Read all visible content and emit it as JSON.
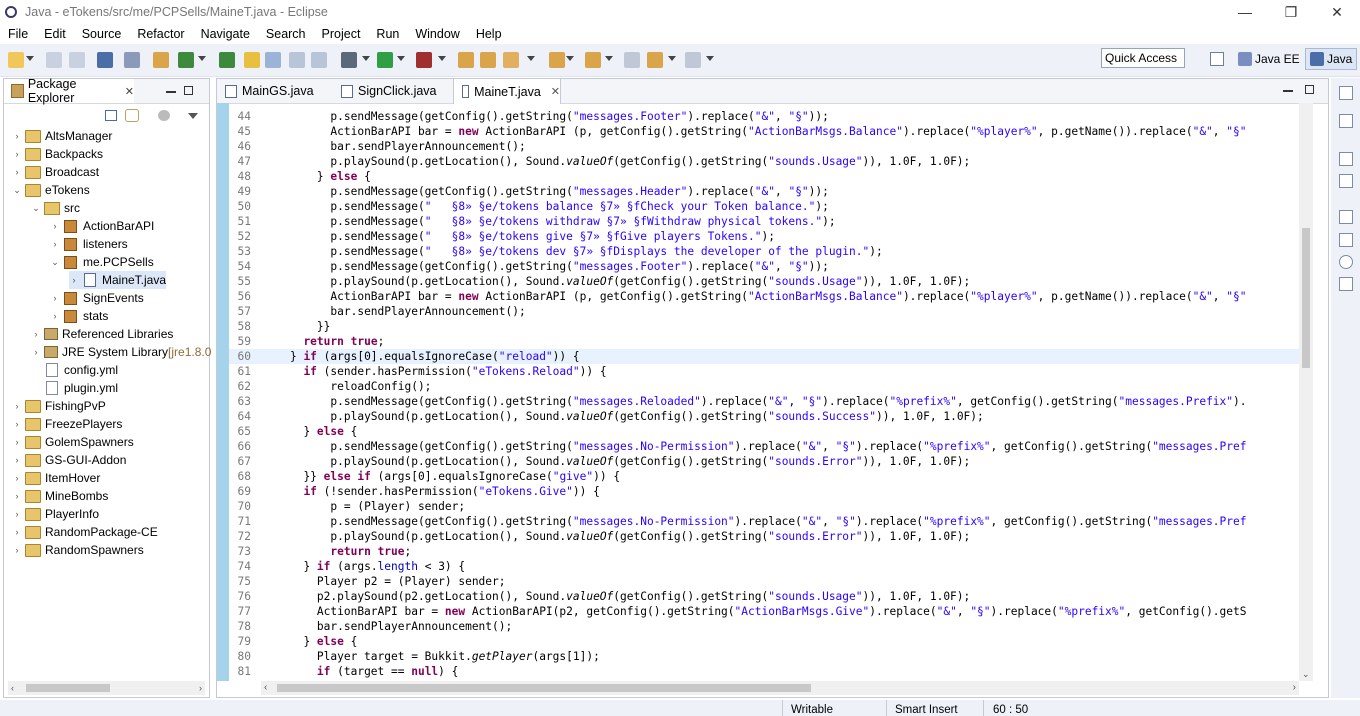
{
  "window": {
    "title": "Java - eTokens/src/me/PCPSells/MaineT.java - Eclipse",
    "minimize": "—",
    "restore": "❐",
    "close": "✕"
  },
  "menu": [
    "File",
    "Edit",
    "Source",
    "Refactor",
    "Navigate",
    "Search",
    "Project",
    "Run",
    "Window",
    "Help"
  ],
  "toolbar": {
    "quick_access": "Quick Access",
    "perspectives": [
      "Java EE",
      "Java"
    ]
  },
  "package_explorer": {
    "title": "Package Explorer",
    "close": "✕",
    "items": [
      {
        "label": "AltsManager",
        "icon": "project-icon",
        "twisty": "›"
      },
      {
        "label": "Backpacks",
        "icon": "project-icon",
        "twisty": "›"
      },
      {
        "label": "Broadcast",
        "icon": "project-icon",
        "twisty": "›"
      },
      {
        "label": "eTokens",
        "icon": "project-icon",
        "twisty": "⌄"
      },
      {
        "label": "src",
        "icon": "source-folder-icon",
        "twisty": "⌄"
      },
      {
        "label": "ActionBarAPI",
        "icon": "package-icon",
        "twisty": "›"
      },
      {
        "label": "listeners",
        "icon": "package-icon",
        "twisty": "›"
      },
      {
        "label": "me.PCPSells",
        "icon": "package-icon",
        "twisty": "⌄"
      },
      {
        "label": "MaineT.java",
        "icon": "java-file-icon",
        "twisty": "›"
      },
      {
        "label": "SignEvents",
        "icon": "package-icon",
        "twisty": "›"
      },
      {
        "label": "stats",
        "icon": "package-icon",
        "twisty": "›"
      },
      {
        "label": "Referenced Libraries",
        "icon": "library-icon",
        "twisty": "›"
      },
      {
        "label": "JRE System Library",
        "suffix": " [jre1.8.0",
        "icon": "library-icon",
        "twisty": "›"
      },
      {
        "label": "config.yml",
        "icon": "yml-file-icon",
        "twisty": ""
      },
      {
        "label": "plugin.yml",
        "icon": "yml-file-icon",
        "twisty": ""
      },
      {
        "label": "FishingPvP",
        "icon": "project-icon",
        "twisty": "›"
      },
      {
        "label": "FreezePlayers",
        "icon": "project-icon",
        "twisty": "›"
      },
      {
        "label": "GolemSpawners",
        "icon": "project-icon",
        "twisty": "›"
      },
      {
        "label": "GS-GUI-Addon",
        "icon": "project-icon",
        "twisty": "›"
      },
      {
        "label": "ItemHover",
        "icon": "project-icon",
        "twisty": "›"
      },
      {
        "label": "MineBombs",
        "icon": "project-icon",
        "twisty": "›"
      },
      {
        "label": "PlayerInfo",
        "icon": "project-icon",
        "twisty": "›"
      },
      {
        "label": "RandomPackage-CE",
        "icon": "project-icon",
        "twisty": "›"
      },
      {
        "label": "RandomSpawners",
        "icon": "project-icon",
        "twisty": "›"
      }
    ]
  },
  "editor": {
    "tabs": [
      {
        "label": "MainGS.java",
        "active": false
      },
      {
        "label": "SignClick.java",
        "active": false
      },
      {
        "label": "MaineT.java",
        "active": true
      }
    ],
    "tab_close": "✕",
    "lines": [
      {
        "n": "44",
        "indent": 10,
        "tokens": [
          [
            "p.sendMessage(getConfig().getString(",
            ""
          ],
          [
            "\"messages.Footer\"",
            "str"
          ],
          [
            ").replace(",
            ""
          ],
          [
            "\"&\"",
            "str"
          ],
          [
            ", ",
            ""
          ],
          [
            "\"§\"",
            "str"
          ],
          [
            "));",
            ""
          ]
        ]
      },
      {
        "n": "45",
        "indent": 10,
        "tokens": [
          [
            "ActionBarAPI bar = ",
            ""
          ],
          [
            "new",
            "kw"
          ],
          [
            " ActionBarAPI (p, getConfig().getString(",
            ""
          ],
          [
            "\"ActionBarMsgs.Balance\"",
            "str"
          ],
          [
            ").replace(",
            ""
          ],
          [
            "\"%player%\"",
            "str"
          ],
          [
            ", p.getName()).replace(",
            ""
          ],
          [
            "\"&\"",
            "str"
          ],
          [
            ", ",
            ""
          ],
          [
            "\"§\"",
            "str"
          ]
        ]
      },
      {
        "n": "46",
        "indent": 10,
        "tokens": [
          [
            "bar.sendPlayerAnnouncement();",
            ""
          ]
        ]
      },
      {
        "n": "47",
        "indent": 10,
        "tokens": [
          [
            "p.playSound(p.getLocation(), Sound.",
            ""
          ],
          [
            "valueOf",
            "it"
          ],
          [
            "(getConfig().getString(",
            ""
          ],
          [
            "\"sounds.Usage\"",
            "str"
          ],
          [
            ")), 1.0F, 1.0F);",
            ""
          ]
        ]
      },
      {
        "n": "48",
        "indent": 8,
        "tokens": [
          [
            "} ",
            ""
          ],
          [
            "else",
            "kw"
          ],
          [
            " {",
            ""
          ]
        ]
      },
      {
        "n": "49",
        "indent": 10,
        "tokens": [
          [
            "p.sendMessage(getConfig().getString(",
            ""
          ],
          [
            "\"messages.Header\"",
            "str"
          ],
          [
            ").replace(",
            ""
          ],
          [
            "\"&\"",
            "str"
          ],
          [
            ", ",
            ""
          ],
          [
            "\"§\"",
            "str"
          ],
          [
            "));",
            ""
          ]
        ]
      },
      {
        "n": "50",
        "indent": 10,
        "tokens": [
          [
            "p.sendMessage(",
            ""
          ],
          [
            "\"   §8» §e/tokens balance §7» §fCheck your Token balance.\"",
            "str"
          ],
          [
            ");",
            ""
          ]
        ]
      },
      {
        "n": "51",
        "indent": 10,
        "tokens": [
          [
            "p.sendMessage(",
            ""
          ],
          [
            "\"   §8» §e/tokens withdraw §7» §fWithdraw physical tokens.\"",
            "str"
          ],
          [
            ");",
            ""
          ]
        ]
      },
      {
        "n": "52",
        "indent": 10,
        "tokens": [
          [
            "p.sendMessage(",
            ""
          ],
          [
            "\"   §8» §e/tokens give §7» §fGive players Tokens.\"",
            "str"
          ],
          [
            ");",
            ""
          ]
        ]
      },
      {
        "n": "53",
        "indent": 10,
        "tokens": [
          [
            "p.sendMessage(",
            ""
          ],
          [
            "\"   §8» §e/tokens dev §7» §fDisplays the developer of the plugin.\"",
            "str"
          ],
          [
            ");",
            ""
          ]
        ]
      },
      {
        "n": "54",
        "indent": 10,
        "tokens": [
          [
            "p.sendMessage(getConfig().getString(",
            ""
          ],
          [
            "\"messages.Footer\"",
            "str"
          ],
          [
            ").replace(",
            ""
          ],
          [
            "\"&\"",
            "str"
          ],
          [
            ", ",
            ""
          ],
          [
            "\"§\"",
            "str"
          ],
          [
            "));",
            ""
          ]
        ]
      },
      {
        "n": "55",
        "indent": 10,
        "tokens": [
          [
            "p.playSound(p.getLocation(), Sound.",
            ""
          ],
          [
            "valueOf",
            "it"
          ],
          [
            "(getConfig().getString(",
            ""
          ],
          [
            "\"sounds.Usage\"",
            "str"
          ],
          [
            ")), 1.0F, 1.0F);",
            ""
          ]
        ]
      },
      {
        "n": "56",
        "indent": 10,
        "tokens": [
          [
            "ActionBarAPI bar = ",
            ""
          ],
          [
            "new",
            "kw"
          ],
          [
            " ActionBarAPI (p, getConfig().getString(",
            ""
          ],
          [
            "\"ActionBarMsgs.Balance\"",
            "str"
          ],
          [
            ").replace(",
            ""
          ],
          [
            "\"%player%\"",
            "str"
          ],
          [
            ", p.getName()).replace(",
            ""
          ],
          [
            "\"&\"",
            "str"
          ],
          [
            ", ",
            ""
          ],
          [
            "\"§\"",
            "str"
          ]
        ]
      },
      {
        "n": "57",
        "indent": 10,
        "tokens": [
          [
            "bar.sendPlayerAnnouncement();",
            ""
          ]
        ]
      },
      {
        "n": "58",
        "indent": 8,
        "tokens": [
          [
            "}}",
            ""
          ]
        ]
      },
      {
        "n": "59",
        "indent": 6,
        "tokens": [
          [
            "return",
            "kw"
          ],
          [
            " ",
            ""
          ],
          [
            "true",
            "kw"
          ],
          [
            ";",
            ""
          ]
        ]
      },
      {
        "n": "60",
        "indent": 4,
        "hl": true,
        "tokens": [
          [
            "} ",
            ""
          ],
          [
            "if",
            "kw"
          ],
          [
            " (args[0].equalsIgnoreCase(",
            ""
          ],
          [
            "\"reload\"",
            "str"
          ],
          [
            ")) {",
            ""
          ]
        ]
      },
      {
        "n": "61",
        "indent": 6,
        "tokens": [
          [
            "if",
            "kw"
          ],
          [
            " (sender.hasPermission(",
            ""
          ],
          [
            "\"eTokens.Reload\"",
            "str"
          ],
          [
            ")) {",
            ""
          ]
        ]
      },
      {
        "n": "62",
        "indent": 10,
        "tokens": [
          [
            "reloadConfig();",
            ""
          ]
        ]
      },
      {
        "n": "63",
        "indent": 10,
        "tokens": [
          [
            "p.sendMessage(getConfig().getString(",
            ""
          ],
          [
            "\"messages.Reloaded\"",
            "str"
          ],
          [
            ").replace(",
            ""
          ],
          [
            "\"&\"",
            "str"
          ],
          [
            ", ",
            ""
          ],
          [
            "\"§\"",
            "str"
          ],
          [
            ").replace(",
            ""
          ],
          [
            "\"%prefix%\"",
            "str"
          ],
          [
            ", getConfig().getString(",
            ""
          ],
          [
            "\"messages.Prefix\"",
            "str"
          ],
          [
            ").",
            ""
          ]
        ]
      },
      {
        "n": "64",
        "indent": 10,
        "tokens": [
          [
            "p.playSound(p.getLocation(), Sound.",
            ""
          ],
          [
            "valueOf",
            "it"
          ],
          [
            "(getConfig().getString(",
            ""
          ],
          [
            "\"sounds.Success\"",
            "str"
          ],
          [
            ")), 1.0F, 1.0F);",
            ""
          ]
        ]
      },
      {
        "n": "65",
        "indent": 6,
        "tokens": [
          [
            "} ",
            ""
          ],
          [
            "else",
            "kw"
          ],
          [
            " {",
            ""
          ]
        ]
      },
      {
        "n": "66",
        "indent": 10,
        "tokens": [
          [
            "p.sendMessage(getConfig().getString(",
            ""
          ],
          [
            "\"messages.No-Permission\"",
            "str"
          ],
          [
            ").replace(",
            ""
          ],
          [
            "\"&\"",
            "str"
          ],
          [
            ", ",
            ""
          ],
          [
            "\"§\"",
            "str"
          ],
          [
            ").replace(",
            ""
          ],
          [
            "\"%prefix%\"",
            "str"
          ],
          [
            ", getConfig().getString(",
            ""
          ],
          [
            "\"messages.Pref",
            "str"
          ]
        ]
      },
      {
        "n": "67",
        "indent": 10,
        "tokens": [
          [
            "p.playSound(p.getLocation(), Sound.",
            ""
          ],
          [
            "valueOf",
            "it"
          ],
          [
            "(getConfig().getString(",
            ""
          ],
          [
            "\"sounds.Error\"",
            "str"
          ],
          [
            ")), 1.0F, 1.0F);",
            ""
          ]
        ]
      },
      {
        "n": "68",
        "indent": 6,
        "tokens": [
          [
            "}} ",
            ""
          ],
          [
            "else",
            "kw"
          ],
          [
            " ",
            ""
          ],
          [
            "if",
            "kw"
          ],
          [
            " (args[0].equalsIgnoreCase(",
            ""
          ],
          [
            "\"give\"",
            "str"
          ],
          [
            ")) {",
            ""
          ]
        ]
      },
      {
        "n": "69",
        "indent": 6,
        "tokens": [
          [
            "if",
            "kw"
          ],
          [
            " (!sender.hasPermission(",
            ""
          ],
          [
            "\"eTokens.Give\"",
            "str"
          ],
          [
            ")) {",
            ""
          ]
        ]
      },
      {
        "n": "70",
        "indent": 10,
        "tokens": [
          [
            "p = (Player) sender;",
            ""
          ]
        ]
      },
      {
        "n": "71",
        "indent": 10,
        "tokens": [
          [
            "p.sendMessage(getConfig().getString(",
            ""
          ],
          [
            "\"messages.No-Permission\"",
            "str"
          ],
          [
            ").replace(",
            ""
          ],
          [
            "\"&\"",
            "str"
          ],
          [
            ", ",
            ""
          ],
          [
            "\"§\"",
            "str"
          ],
          [
            ").replace(",
            ""
          ],
          [
            "\"%prefix%\"",
            "str"
          ],
          [
            ", getConfig().getString(",
            ""
          ],
          [
            "\"messages.Pref",
            "str"
          ]
        ]
      },
      {
        "n": "72",
        "indent": 10,
        "tokens": [
          [
            "p.playSound(p.getLocation(), Sound.",
            ""
          ],
          [
            "valueOf",
            "it"
          ],
          [
            "(getConfig().getString(",
            ""
          ],
          [
            "\"sounds.Error\"",
            "str"
          ],
          [
            ")), 1.0F, 1.0F);",
            ""
          ]
        ]
      },
      {
        "n": "73",
        "indent": 10,
        "tokens": [
          [
            "return",
            "kw"
          ],
          [
            " ",
            ""
          ],
          [
            "true",
            "kw"
          ],
          [
            ";",
            ""
          ]
        ]
      },
      {
        "n": "74",
        "indent": 6,
        "tokens": [
          [
            "} ",
            ""
          ],
          [
            "if",
            "kw"
          ],
          [
            " (args.",
            ""
          ],
          [
            "length",
            "fld"
          ],
          [
            " < 3) {",
            ""
          ]
        ]
      },
      {
        "n": "75",
        "indent": 8,
        "tokens": [
          [
            "Player p2 = (Player) sender;",
            ""
          ]
        ]
      },
      {
        "n": "76",
        "indent": 8,
        "tokens": [
          [
            "p2.playSound(p2.getLocation(), Sound.",
            ""
          ],
          [
            "valueOf",
            "it"
          ],
          [
            "(getConfig().getString(",
            ""
          ],
          [
            "\"sounds.Usage\"",
            "str"
          ],
          [
            ")), 1.0F, 1.0F);",
            ""
          ]
        ]
      },
      {
        "n": "77",
        "indent": 8,
        "tokens": [
          [
            "ActionBarAPI bar = ",
            ""
          ],
          [
            "new",
            "kw"
          ],
          [
            " ActionBarAPI(p2, getConfig().getString(",
            ""
          ],
          [
            "\"ActionBarMsgs.Give\"",
            "str"
          ],
          [
            ").replace(",
            ""
          ],
          [
            "\"&\"",
            "str"
          ],
          [
            ", ",
            ""
          ],
          [
            "\"§\"",
            "str"
          ],
          [
            ").replace(",
            ""
          ],
          [
            "\"%prefix%\"",
            "str"
          ],
          [
            ", getConfig().getS",
            ""
          ]
        ]
      },
      {
        "n": "78",
        "indent": 8,
        "tokens": [
          [
            "bar.sendPlayerAnnouncement();",
            ""
          ]
        ]
      },
      {
        "n": "79",
        "indent": 6,
        "tokens": [
          [
            "} ",
            ""
          ],
          [
            "else",
            "kw"
          ],
          [
            " {",
            ""
          ]
        ]
      },
      {
        "n": "80",
        "indent": 8,
        "tokens": [
          [
            "Player target = Bukkit.",
            ""
          ],
          [
            "getPlayer",
            "it"
          ],
          [
            "(args[1]);",
            ""
          ]
        ]
      },
      {
        "n": "81",
        "indent": 8,
        "tokens": [
          [
            "if",
            "kw"
          ],
          [
            " (target == ",
            ""
          ],
          [
            "null",
            "kw"
          ],
          [
            ") {",
            ""
          ]
        ]
      }
    ]
  },
  "status_bar": {
    "mode": "Writable",
    "insert": "Smart Insert",
    "position": "60 : 50"
  }
}
